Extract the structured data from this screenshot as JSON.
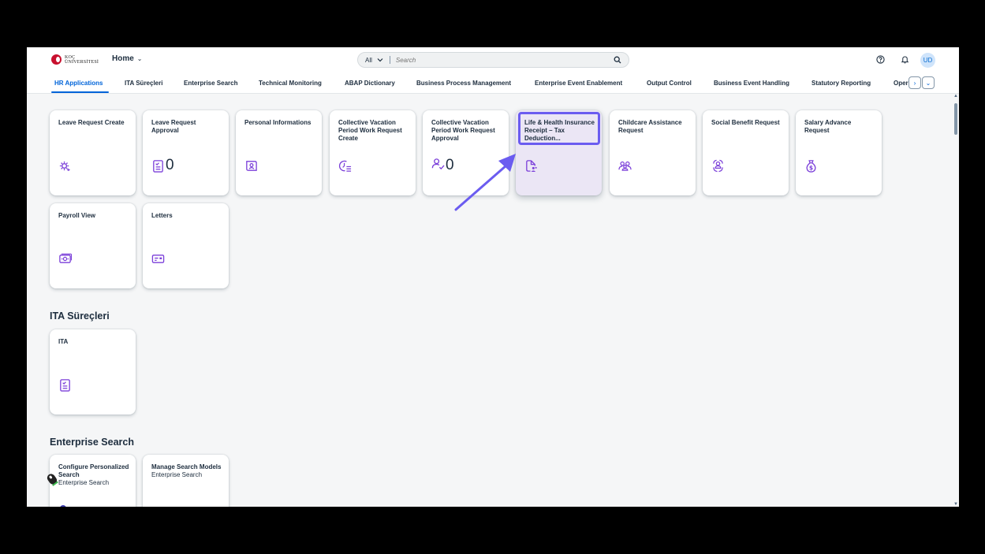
{
  "shell": {
    "logo_text_line1": "KOÇ",
    "logo_text_line2": "ÜNİVERSİTESİ",
    "home_label": "Home",
    "search_scope": "All",
    "search_placeholder": "Search",
    "avatar_initials": "UD"
  },
  "tabs": [
    {
      "label": "HR Applications",
      "active": true
    },
    {
      "label": "ITA Süreçleri"
    },
    {
      "label": "Enterprise Search"
    },
    {
      "label": "Technical Monitoring"
    },
    {
      "label": "ABAP Dictionary"
    },
    {
      "label": "Business Process Management"
    },
    {
      "label": "Enterprise Event Enablement"
    },
    {
      "label": "Output Control"
    },
    {
      "label": "Business Event Handling"
    },
    {
      "label": "Statutory Reporting"
    },
    {
      "label": "Oper"
    }
  ],
  "sections": [
    {
      "title": "",
      "tiles": [
        {
          "title": "Leave Request Create",
          "icon": "gear-sparkle-icon"
        },
        {
          "title": "Leave Request Approval",
          "icon": "checklist-icon",
          "number": "0"
        },
        {
          "title": "Personal Informations",
          "icon": "personal-card-icon"
        },
        {
          "title": "Collective Vacation Period Work Request Create",
          "icon": "clock-list-icon"
        },
        {
          "title": "Collective Vacation Period Work Request Approval",
          "icon": "person-check-icon",
          "number": "0"
        },
        {
          "title": "Life & Health Insurance Receipt – Tax Deduction...",
          "icon": "document-people-icon",
          "selected": true
        },
        {
          "title": "Childcare Assistance Request",
          "icon": "family-icon"
        },
        {
          "title": "Social Benefit Request",
          "icon": "group-cycle-icon"
        },
        {
          "title": "Salary Advance Request",
          "icon": "money-bag-icon"
        },
        {
          "title": "Payroll View",
          "icon": "money-bills-icon"
        },
        {
          "title": "Letters",
          "icon": "card-icon"
        }
      ]
    },
    {
      "title": "ITA Süreçleri",
      "tiles": [
        {
          "title": "ITA",
          "icon": "checklist-icon"
        }
      ]
    },
    {
      "title": "Enterprise Search",
      "tiles": [
        {
          "title": "Configure Personalized Search",
          "subtitle": "Enterprise Search"
        },
        {
          "title": "Manage Search Models",
          "subtitle": "Enterprise Search"
        }
      ]
    }
  ],
  "colors": {
    "accent": "#0064d9",
    "tile_icon": "#7b3fd9",
    "annotation": "#6b5cf0"
  }
}
